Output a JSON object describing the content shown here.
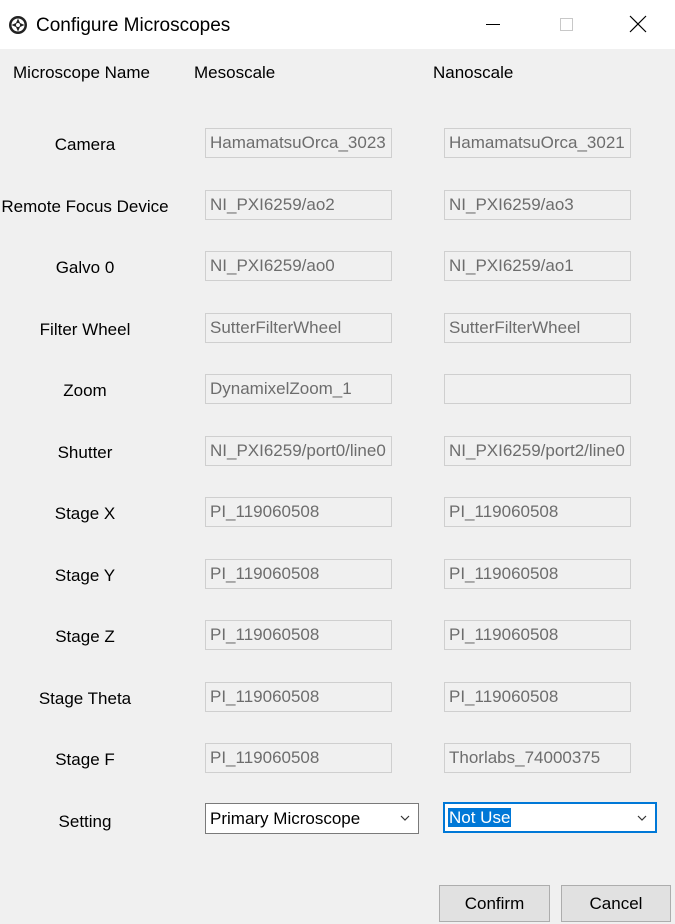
{
  "window": {
    "title": "Configure Microscopes"
  },
  "headers": {
    "name": "Microscope Name",
    "col1": "Mesoscale",
    "col2": "Nanoscale"
  },
  "rows": [
    {
      "label": "Camera",
      "col1": "HamamatsuOrca_3023",
      "col2": "HamamatsuOrca_3021"
    },
    {
      "label": "Remote Focus Device",
      "col1": "NI_PXI6259/ao2",
      "col2": "NI_PXI6259/ao3"
    },
    {
      "label": "Galvo 0",
      "col1": "NI_PXI6259/ao0",
      "col2": "NI_PXI6259/ao1"
    },
    {
      "label": "Filter Wheel",
      "col1": "SutterFilterWheel",
      "col2": "SutterFilterWheel"
    },
    {
      "label": "Zoom",
      "col1": "DynamixelZoom_1",
      "col2": ""
    },
    {
      "label": "Shutter",
      "col1": "NI_PXI6259/port0/line0",
      "col2": "NI_PXI6259/port2/line0"
    },
    {
      "label": "Stage X",
      "col1": "PI_119060508",
      "col2": "PI_119060508"
    },
    {
      "label": "Stage Y",
      "col1": "PI_119060508",
      "col2": "PI_119060508"
    },
    {
      "label": "Stage Z",
      "col1": "PI_119060508",
      "col2": "PI_119060508"
    },
    {
      "label": "Stage Theta",
      "col1": "PI_119060508",
      "col2": "PI_119060508"
    },
    {
      "label": "Stage F",
      "col1": "PI_119060508",
      "col2": "Thorlabs_74000375"
    }
  ],
  "setting": {
    "label": "Setting",
    "col1": "Primary Microscope",
    "col2": "Not Use"
  },
  "buttons": {
    "confirm": "Confirm",
    "cancel": "Cancel"
  },
  "colors": {
    "focus_accent": "#0078d7",
    "dialog_bg": "#f0f0f0"
  }
}
